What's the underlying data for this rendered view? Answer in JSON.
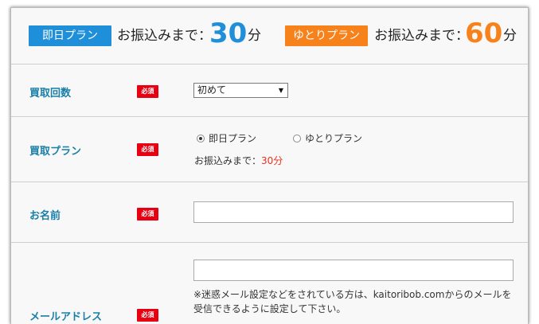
{
  "plans": {
    "sameday": {
      "badge": "即日プラン",
      "label": "お振込みまで：",
      "minutes": "30",
      "unit": "分",
      "color": "#1e8fd8"
    },
    "relaxed": {
      "badge": "ゆとりプラン",
      "label": "お振込みまで：",
      "minutes": "60",
      "unit": "分",
      "color": "#f7821b"
    }
  },
  "required_label": "必須",
  "form": {
    "purchase_count": {
      "label": "買取回数",
      "selected": "初めて"
    },
    "purchase_plan": {
      "label": "買取プラン",
      "options": [
        {
          "label": "即日プラン",
          "checked": true
        },
        {
          "label": "ゆとりプラン",
          "checked": false
        }
      ],
      "transfer_label": "お振込みまで：",
      "transfer_value": "30分"
    },
    "name": {
      "label": "お名前",
      "value": ""
    },
    "email": {
      "label": "メールアドレス",
      "value": "",
      "note": "※迷惑メール設定などをされている方は、kaitoribob.comからのメールを受信できるように設定して下さい。"
    }
  },
  "icons": {
    "select_arrow": "dropdown-triangle",
    "radio": "radio-circle"
  }
}
